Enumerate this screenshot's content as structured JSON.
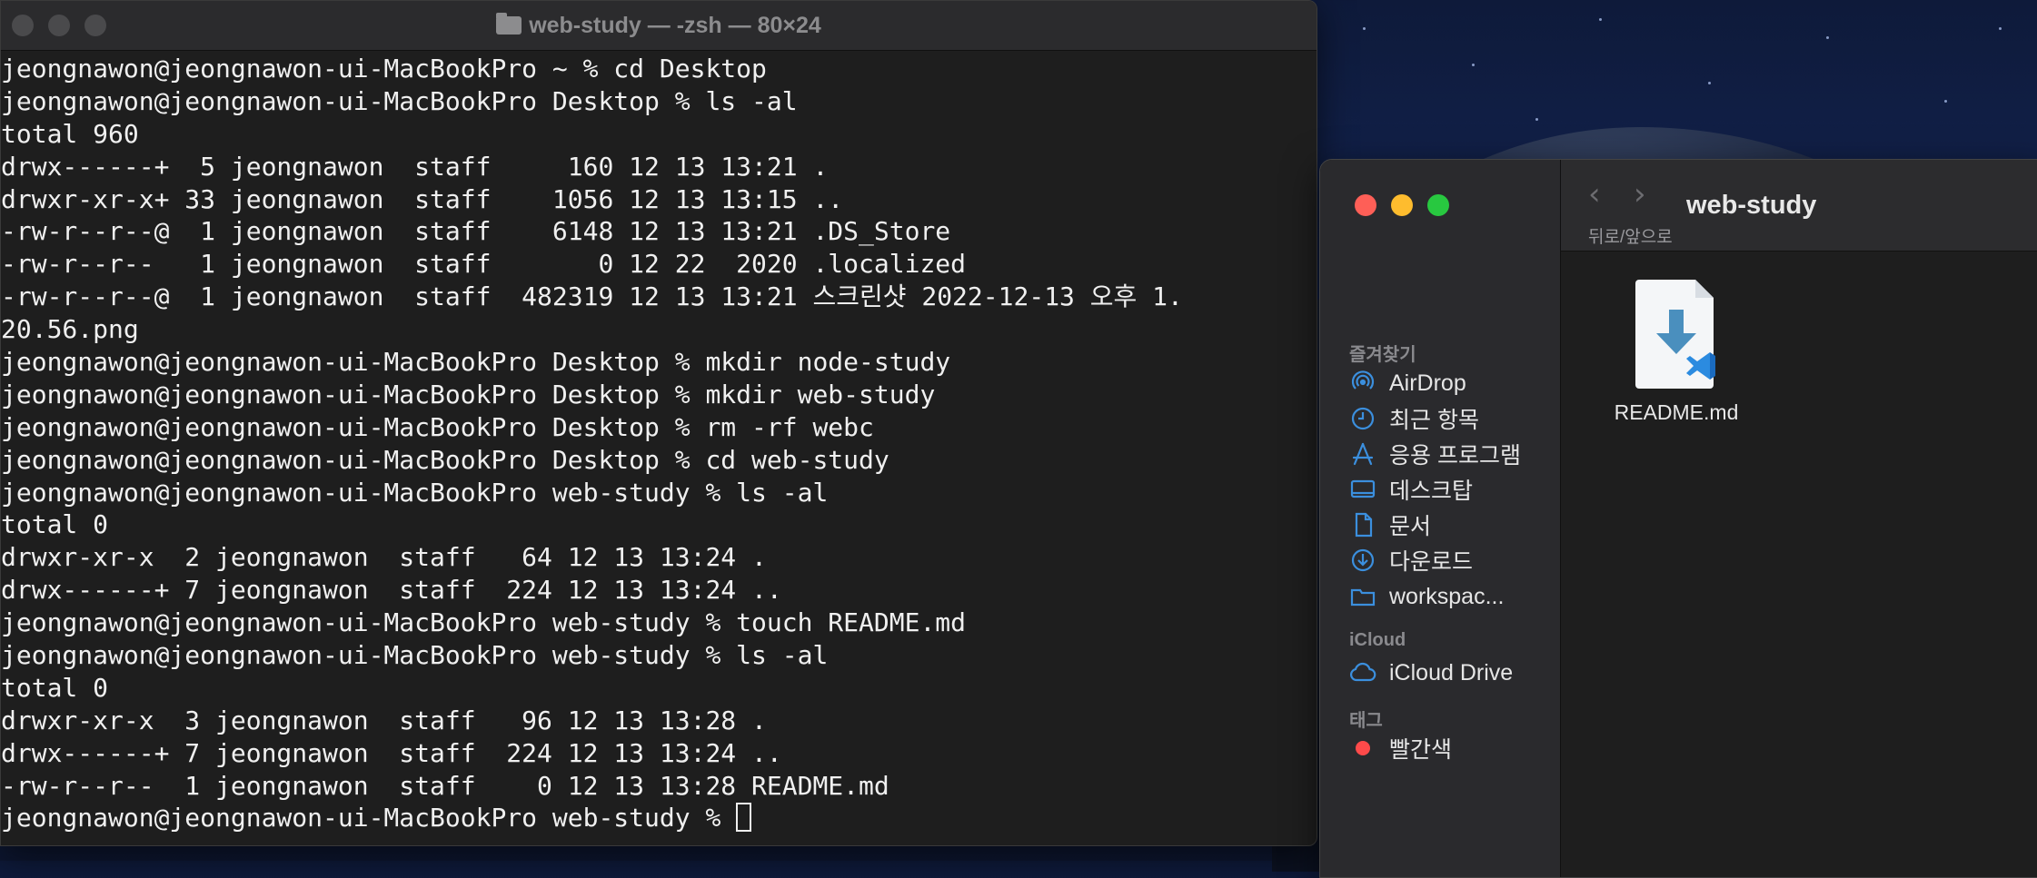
{
  "terminal": {
    "title": "web-study — -zsh — 80×24",
    "lines": [
      "jeongnawon@jeongnawon-ui-MacBookPro ~ % cd Desktop",
      "jeongnawon@jeongnawon-ui-MacBookPro Desktop % ls -al",
      "total 960",
      "drwx------+  5 jeongnawon  staff     160 12 13 13:21 .",
      "drwxr-xr-x+ 33 jeongnawon  staff    1056 12 13 13:15 ..",
      "-rw-r--r--@  1 jeongnawon  staff    6148 12 13 13:21 .DS_Store",
      "-rw-r--r--   1 jeongnawon  staff       0 12 22  2020 .localized",
      "-rw-r--r--@  1 jeongnawon  staff  482319 12 13 13:21 스크린샷 2022-12-13 오후 1.",
      "20.56.png",
      "jeongnawon@jeongnawon-ui-MacBookPro Desktop % mkdir node-study",
      "jeongnawon@jeongnawon-ui-MacBookPro Desktop % mkdir web-study",
      "jeongnawon@jeongnawon-ui-MacBookPro Desktop % rm -rf webc",
      "jeongnawon@jeongnawon-ui-MacBookPro Desktop % cd web-study",
      "jeongnawon@jeongnawon-ui-MacBookPro web-study % ls -al",
      "total 0",
      "drwxr-xr-x  2 jeongnawon  staff   64 12 13 13:24 .",
      "drwx------+ 7 jeongnawon  staff  224 12 13 13:24 ..",
      "jeongnawon@jeongnawon-ui-MacBookPro web-study % touch README.md",
      "jeongnawon@jeongnawon-ui-MacBookPro web-study % ls -al",
      "total 0",
      "drwxr-xr-x  3 jeongnawon  staff   96 12 13 13:28 .",
      "drwx------+ 7 jeongnawon  staff  224 12 13 13:24 ..",
      "-rw-r--r--  1 jeongnawon  staff    0 12 13 13:28 README.md",
      "jeongnawon@jeongnawon-ui-MacBookPro web-study % "
    ]
  },
  "finder": {
    "title": "web-study",
    "nav_back": "‹",
    "nav_forward": "›",
    "nav_label": "뒤로/앞으로",
    "sections": {
      "favorites": "즐겨찾기",
      "icloud": "iCloud",
      "tags": "태그"
    },
    "favorites": [
      {
        "label": "AirDrop",
        "icon": "airdrop-icon"
      },
      {
        "label": "최근 항목",
        "icon": "clock-icon"
      },
      {
        "label": "응용 프로그램",
        "icon": "applications-icon"
      },
      {
        "label": "데스크탑",
        "icon": "desktop-icon"
      },
      {
        "label": "문서",
        "icon": "document-icon"
      },
      {
        "label": "다운로드",
        "icon": "download-icon"
      },
      {
        "label": "workspac...",
        "icon": "folder-icon"
      }
    ],
    "icloud_items": [
      {
        "label": "iCloud Drive",
        "icon": "cloud-icon"
      }
    ],
    "tags": [
      {
        "label": "빨간색",
        "color": "#fe4a4a"
      }
    ],
    "files": [
      {
        "name": "README.md",
        "icon": "markdown-file-icon"
      }
    ],
    "accent": "#3b8fde"
  }
}
